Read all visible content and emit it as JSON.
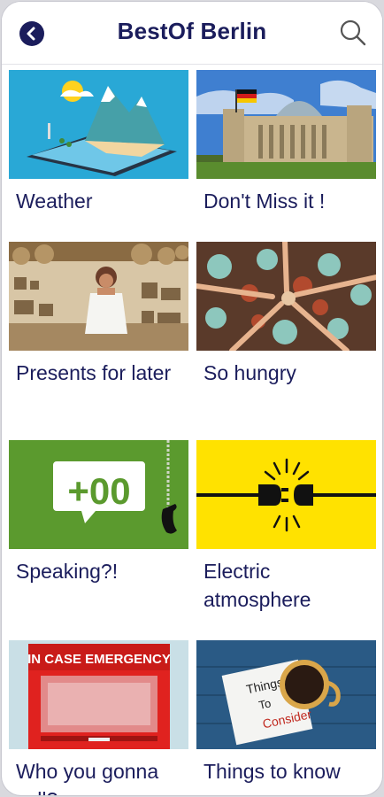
{
  "header": {
    "title": "BestOf Berlin"
  },
  "cards": [
    {
      "label": "Weather"
    },
    {
      "label": "Don't Miss it !"
    },
    {
      "label": "Presents for later"
    },
    {
      "label": "So hungry"
    },
    {
      "label": "Speaking?!",
      "image_text": "+00"
    },
    {
      "label": "Electric atmosphere"
    },
    {
      "label": "Who you gonna call?",
      "image_text": "IN CASE EMERGENCY"
    },
    {
      "label": "Things to know",
      "image_text_1": "Things",
      "image_text_2": "To",
      "image_text_3": "Consider"
    }
  ],
  "colors": {
    "brand": "#1b1d5c",
    "card_speaking_bg": "#5b9a2e",
    "card_electric_bg": "#ffe200",
    "card_emergency_bg": "#e0221f"
  }
}
